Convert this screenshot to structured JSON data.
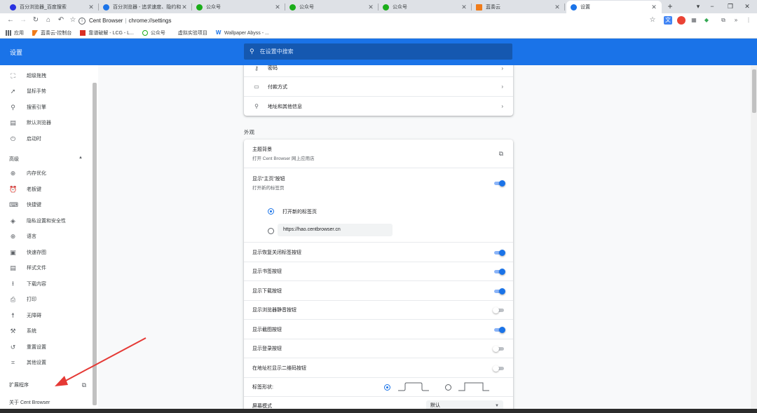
{
  "tabs": [
    {
      "title": "百分浏览器_百度搜索",
      "favicon_color": "#2932e1"
    },
    {
      "title": "百分浏览器 - 追求速度、隐约和...",
      "favicon_color": "#1a73e8"
    },
    {
      "title": "公众号",
      "favicon_color": "#1aad19"
    },
    {
      "title": "公众号",
      "favicon_color": "#1aad19"
    },
    {
      "title": "公众号",
      "favicon_color": "#1aad19"
    },
    {
      "title": "蓝奏云",
      "favicon_color": "#f07c1a"
    },
    {
      "title": "设置",
      "favicon_color": "#1a73e8"
    }
  ],
  "toolbar": {
    "site_name": "Cent Browser",
    "divider": "|",
    "url": "chrome://settings"
  },
  "bookmarks": [
    {
      "label": "应用",
      "icon": "apps-grid-icon",
      "color": "#5f6368"
    },
    {
      "label": "蓝奏云-控制台",
      "icon": "lanzou-flag-icon",
      "color": "#f07c1a"
    },
    {
      "label": "靠谱破解 - LCG - L...",
      "icon": "lcg-icon",
      "color": "#d93025"
    },
    {
      "label": "公众号",
      "icon": "wechat-icon",
      "color": "#1aad19"
    },
    {
      "label": "虚拟实验项目",
      "icon": "",
      "color": ""
    },
    {
      "label": "Wallpaper Abyss - ...",
      "icon": "wallpaper-icon",
      "color": "#1a73e8"
    }
  ],
  "header": {
    "title": "设置",
    "search_placeholder": "在设置中搜索"
  },
  "sidebar": {
    "items_top": [
      {
        "label": "超级拖拽",
        "icon": "drag-icon",
        "glyph": "⛶"
      },
      {
        "label": "鼠标手势",
        "icon": "cursor-icon",
        "glyph": "➚"
      },
      {
        "label": "搜索引擎",
        "icon": "search-icon",
        "glyph": "⚲"
      },
      {
        "label": "默认浏览器",
        "icon": "browser-window-icon",
        "glyph": "▤"
      },
      {
        "label": "启动时",
        "icon": "power-icon",
        "glyph": "⏻"
      }
    ],
    "advanced_label": "高级",
    "advanced_caret": "▲",
    "items_advanced": [
      {
        "label": "内存优化",
        "icon": "globe-icon",
        "glyph": "⊕"
      },
      {
        "label": "老板键",
        "icon": "alarm-icon",
        "glyph": "⏰"
      },
      {
        "label": "快捷键",
        "icon": "keyboard-icon",
        "glyph": "⌨"
      },
      {
        "label": "隐私设置和安全性",
        "icon": "shield-icon",
        "glyph": "◈"
      },
      {
        "label": "语言",
        "icon": "language-globe-icon",
        "glyph": "⊕"
      },
      {
        "label": "快速存图",
        "icon": "image-icon",
        "glyph": "▣"
      },
      {
        "label": "样式文件",
        "icon": "style-file-icon",
        "glyph": "▤"
      },
      {
        "label": "下载内容",
        "icon": "download-icon",
        "glyph": "⭳"
      },
      {
        "label": "打印",
        "icon": "print-icon",
        "glyph": "⎙"
      },
      {
        "label": "无障碍",
        "icon": "accessibility-icon",
        "glyph": "☨"
      },
      {
        "label": "系统",
        "icon": "wrench-icon",
        "glyph": "🔧"
      },
      {
        "label": "重置设置",
        "icon": "reset-history-icon",
        "glyph": "↺"
      },
      {
        "label": "其他设置",
        "icon": "other-settings-icon",
        "glyph": "⌗"
      }
    ],
    "extensions_label": "扩展程序",
    "about_label": "关于 Cent Browser"
  },
  "autofill": {
    "items": [
      {
        "label": "密码",
        "icon": "key-icon",
        "glyph": "⚷"
      },
      {
        "label": "付款方式",
        "icon": "credit-card-icon",
        "glyph": "▭"
      },
      {
        "label": "地址和其他信息",
        "icon": "location-pin-icon",
        "glyph": "⚲"
      }
    ],
    "arrow": "›"
  },
  "appearance": {
    "section_title": "外观",
    "theme": {
      "label": "主题背景",
      "sub": "打开 Cent Browser 网上应用店"
    },
    "home_button": {
      "label": "显示“主页”按钮",
      "sub": "打开新的标签页",
      "on": true
    },
    "home_option_newtab": "打开新的标签页",
    "home_option_url": "https://hao.centbrowser.cn",
    "toggles": [
      {
        "label": "显示恢复关闭标签按钮",
        "on": true
      },
      {
        "label": "显示书签按钮",
        "on": true
      },
      {
        "label": "显示下载按钮",
        "on": true
      },
      {
        "label": "显示浏览器静音按钮",
        "on": false
      },
      {
        "label": "显示截图按钮",
        "on": true
      },
      {
        "label": "显示登录按钮",
        "on": false
      },
      {
        "label": "在地址栏显示二维码按钮",
        "on": false
      }
    ],
    "tab_shape_label": "标签形状:",
    "tab_shape_selected": "first",
    "page_zoom_label": "屏幕模式",
    "page_zoom_value": "默认"
  },
  "colors": {
    "accent": "#1a73e8",
    "header_bg": "#1a73e8",
    "annotation_arrow": "#e53935"
  }
}
